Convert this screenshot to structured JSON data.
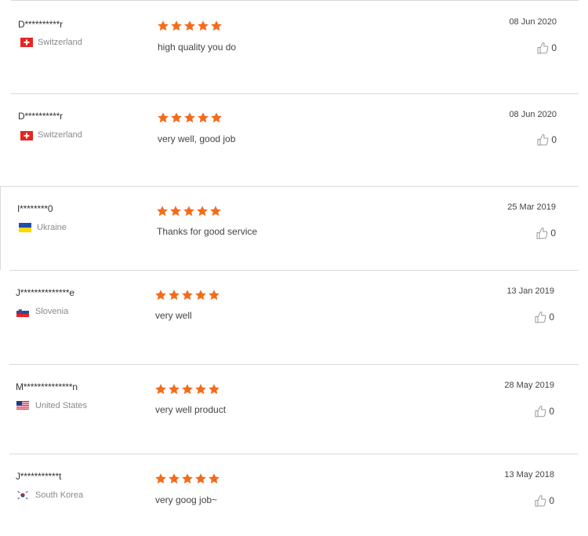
{
  "reviews": [
    {
      "username": "D**********r",
      "country": "Switzerland",
      "flag": "switzerland-flag",
      "rating": 5,
      "comment": "high quality you do",
      "date": "08 Jun 2020",
      "likes": "0"
    },
    {
      "username": "D**********r",
      "country": "Switzerland",
      "flag": "switzerland-flag",
      "rating": 5,
      "comment": "very well, good job",
      "date": "08 Jun 2020",
      "likes": "0"
    },
    {
      "username": "I********0",
      "country": "Ukraine",
      "flag": "ukraine-flag",
      "rating": 5,
      "comment": "Thanks for good service",
      "date": "25 Mar 2019",
      "likes": "0"
    },
    {
      "username": "J**************e",
      "country": "Slovenia",
      "flag": "slovenia-flag",
      "rating": 5,
      "comment": "very well",
      "date": "13 Jan 2019",
      "likes": "0"
    },
    {
      "username": "M**************n",
      "country": "United States",
      "flag": "united-states-flag",
      "rating": 5,
      "comment": "very well product",
      "date": "28 May 2019",
      "likes": "0"
    },
    {
      "username": "J***********t",
      "country": "South Korea",
      "flag": "south-korea-flag",
      "rating": 5,
      "comment": "very goog job~",
      "date": "13 May 2018",
      "likes": "0"
    }
  ],
  "colors": {
    "star": "#f46b1b",
    "separator": "#d9d9d9",
    "country_text": "#8a8a8a",
    "like_icon": "#9a9a9a"
  },
  "icons": {
    "rating": "star-icon",
    "like": "thumbs-up-icon"
  }
}
